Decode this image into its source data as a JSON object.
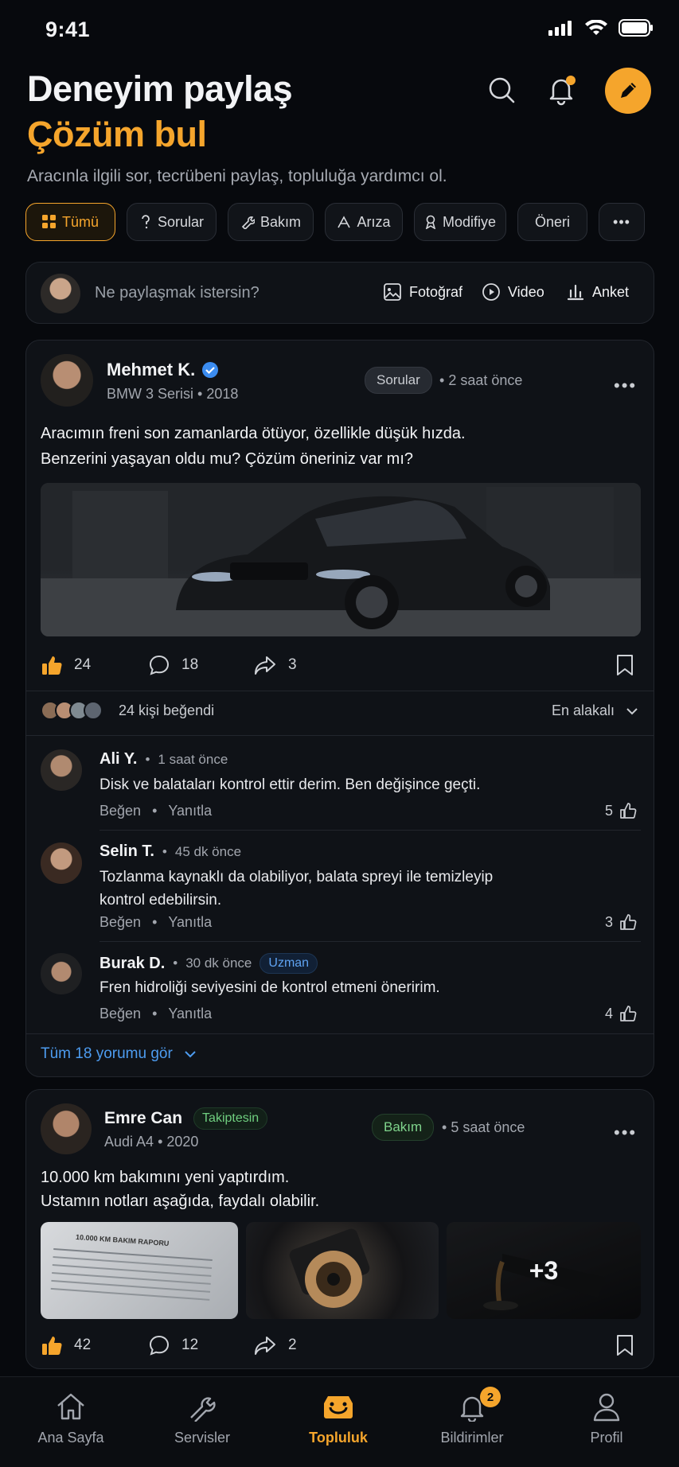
{
  "status_bar": {
    "time": "9:41"
  },
  "header": {
    "title_line1": "Deneyim paylaş",
    "title_line2": "Çözüm bul",
    "subtitle": "Aracınla ilgili sor, tecrübeni paylaş, topluluğa yardımcı ol.",
    "accent": "#f5a52c"
  },
  "filters": [
    "Tümü",
    "Sorular",
    "Bakım",
    "Arıza",
    "Modifiye",
    "Öneri",
    "•••"
  ],
  "composer": {
    "placeholder": "Ne paylaşmak istersin?",
    "photo_label": "Fotoğraf",
    "video_label": "Video",
    "poll_label": "Anket"
  },
  "post1": {
    "author": "Mehmet K.",
    "car": "BMW 3 Serisi",
    "year": "2018",
    "category": "Sorular",
    "time": "2 saat önce",
    "text_line1": "Aracımın freni son zamanlarda ötüyor, özellikle düşük hızda.",
    "text_line2": "Benzerini yaşayan oldu mu? Çözüm öneriniz var mı?",
    "likes": "24",
    "comments": "18",
    "shares": "3",
    "liked_by": "24 kişi beğendi",
    "sort": "En alakalı",
    "comment_list": [
      {
        "name": "Ali Y.",
        "time": "1 saat önce",
        "text": "Disk ve balataları kontrol ettir derim. Ben değişince geçti.",
        "likes": "5"
      },
      {
        "name": "Selin T.",
        "time": "45 dk önce",
        "text": "Tozlanma kaynaklı da olabiliyor, balata spreyi ile temizleyip kontrol edebilirsin.",
        "likes": "3"
      },
      {
        "name": "Burak D.",
        "time": "30 dk önce",
        "badge": "Uzman",
        "text": "Fren hidroliği seviyesini de kontrol etmeni öneririm.",
        "likes": "4"
      }
    ],
    "like_action": "Beğen",
    "reply_action": "Yanıtla",
    "see_all": "Tüm 18 yorumu gör"
  },
  "post2": {
    "author": "Emre Can",
    "follow_badge": "Takiptesin",
    "car": "Audi A4",
    "year": "2020",
    "category": "Bakım",
    "time": "5 saat önce",
    "text_line1": "10.000 km bakımını yeni yaptırdım.",
    "text_line2": "Ustamın notları aşağıda, faydalı olabilir.",
    "doc_text": "10.000 KM BAKIM RAPORU",
    "more_images": "+3",
    "likes": "42",
    "comments": "12",
    "shares": "2"
  },
  "nav": {
    "home": "Ana Sayfa",
    "services": "Servisler",
    "community": "Topluluk",
    "notifications": "Bildirimler",
    "notif_count": "2",
    "profile": "Profil"
  }
}
